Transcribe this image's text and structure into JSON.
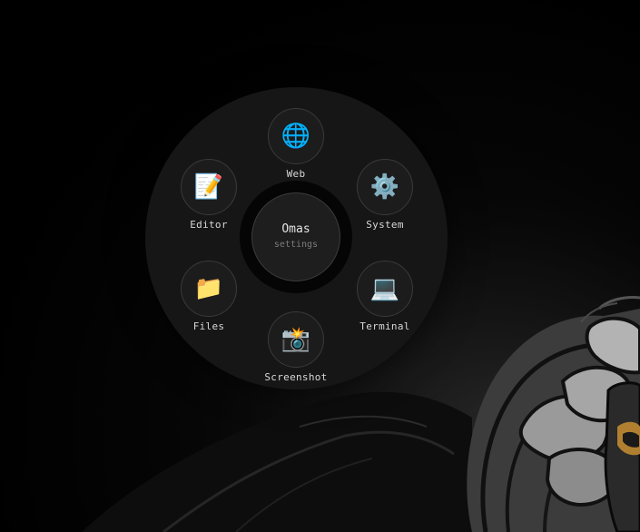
{
  "menu": {
    "center": {
      "title": "Omas",
      "subtitle": "settings"
    },
    "items": [
      {
        "label": "Web",
        "icon": "globe-icon",
        "glyph": "🌐"
      },
      {
        "label": "System",
        "icon": "gear-icon",
        "glyph": "⚙️"
      },
      {
        "label": "Terminal",
        "icon": "laptop-icon",
        "glyph": "💻"
      },
      {
        "label": "Screenshot",
        "icon": "camera-flash-icon",
        "glyph": "📸"
      },
      {
        "label": "Files",
        "icon": "folder-icon",
        "glyph": "📁"
      },
      {
        "label": "Editor",
        "icon": "memo-icon",
        "glyph": "📝"
      }
    ]
  },
  "colors": {
    "background": "#000000",
    "menu_disc": "#171717",
    "item_fill": "#1c1c1c",
    "item_border": "#3a3a3a",
    "label_text": "#d8d8d8",
    "subtitle_text": "#7c7c7c"
  }
}
